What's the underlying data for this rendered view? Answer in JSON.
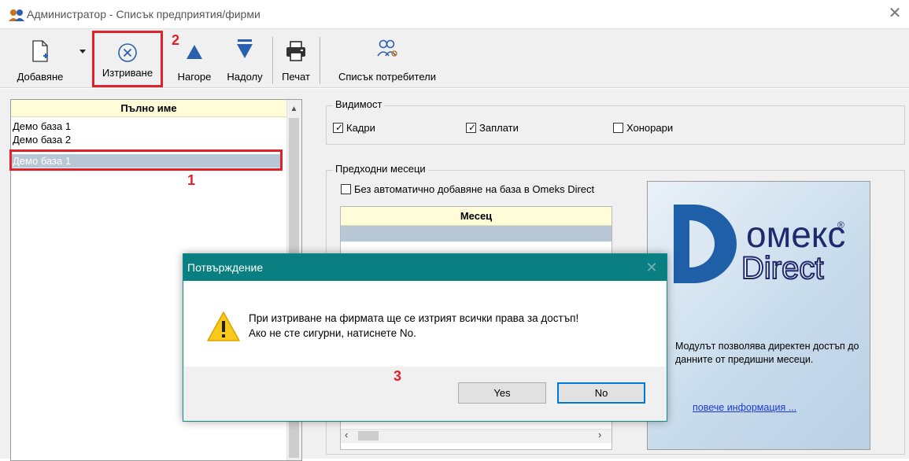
{
  "window": {
    "title": "Администратор - Списък предприятия/фирми",
    "close_symbol": "✕",
    "icon": "users-key-icon"
  },
  "toolbar": {
    "add_label": "Добавяне",
    "delete_label": "Изтриване",
    "up_label": "Нагоре",
    "down_label": "Надолу",
    "print_label": "Печат",
    "users_label": "Списък потребители"
  },
  "annotations": {
    "n1": "1",
    "n2": "2",
    "n3": "3",
    "color": "#e0222a"
  },
  "company_list": {
    "header": "Пълно име",
    "rows": [
      "Демо база 1",
      "Демо база 2",
      "Демо база 1"
    ],
    "selected_index": 2
  },
  "visibility": {
    "title": "Видимост",
    "options": [
      {
        "label": "Кадри",
        "checked": true
      },
      {
        "label": "Заплати",
        "checked": true
      },
      {
        "label": "Хонорари",
        "checked": false
      }
    ]
  },
  "previous_months": {
    "title": "Предходни месеци",
    "auto_add_label": "Без автоматично добавяне на база в Omeks Direct",
    "auto_add_checked": false,
    "grid_header": "Месец"
  },
  "omeks": {
    "logo_line1": "омекс",
    "logo_line2": "Direct",
    "registered": "®",
    "description": "Модулът позволява директен достъп до данните от предишни месеци.",
    "link": "повече информация ..."
  },
  "dialog": {
    "title": "Потвърждение",
    "close_symbol": "✕",
    "message_line1": "При изтриване на фирмата ще се изтрият всички права за достъп!",
    "message_line2": "Ако не сте сигурни, натиснете No.",
    "yes_label": "Yes",
    "no_label": "No"
  },
  "colors": {
    "dialog_title_bg": "#0a7f82",
    "grid_header_bg": "#fffcd8",
    "selection_bg": "#b8c7d6",
    "logo_blue": "#1f5fa8"
  }
}
